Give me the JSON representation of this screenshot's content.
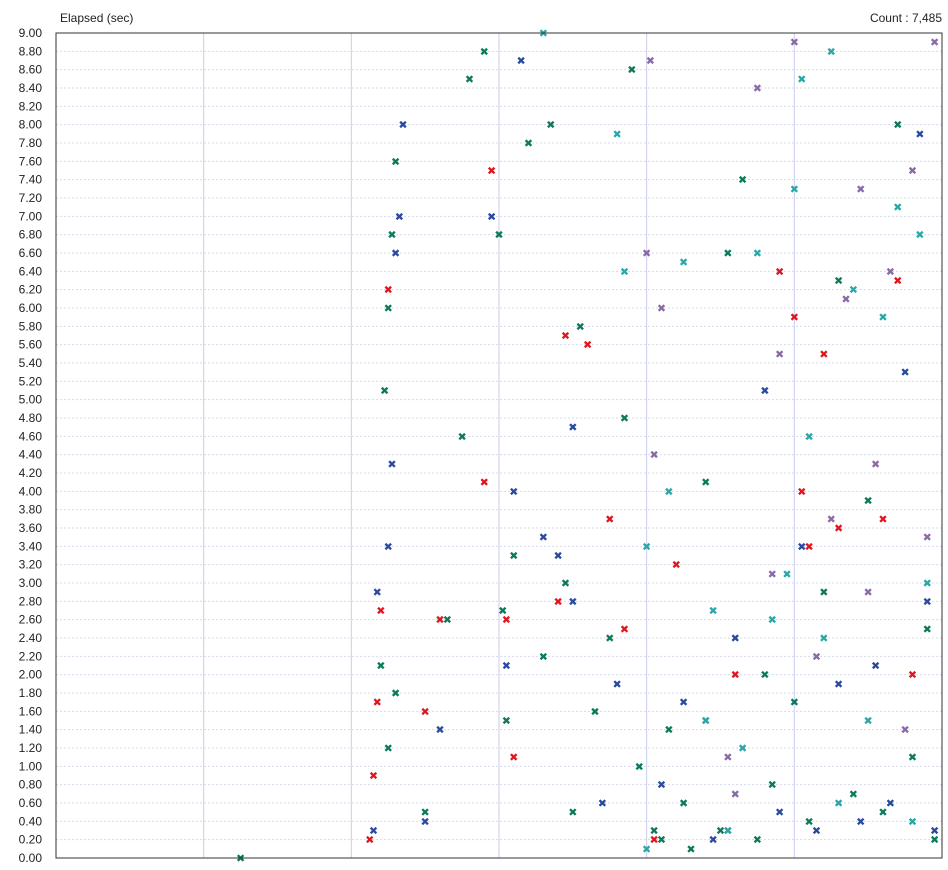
{
  "chart_data": {
    "type": "scatter",
    "title": "",
    "ylabel": "Elapsed (sec)",
    "xlabel": "",
    "count_label": "Count : 7,485",
    "ylim": [
      0,
      9.0
    ],
    "yticks": [
      "0.00",
      "0.20",
      "0.40",
      "0.60",
      "0.80",
      "1.00",
      "1.20",
      "1.40",
      "1.60",
      "1.80",
      "2.00",
      "2.20",
      "2.40",
      "2.60",
      "2.80",
      "3.00",
      "3.20",
      "3.40",
      "3.60",
      "3.80",
      "4.00",
      "4.20",
      "4.40",
      "4.60",
      "4.80",
      "5.00",
      "5.20",
      "5.40",
      "5.60",
      "5.80",
      "6.00",
      "6.20",
      "6.40",
      "6.60",
      "6.80",
      "7.00",
      "7.20",
      "7.40",
      "7.60",
      "7.80",
      "8.00",
      "8.20",
      "8.40",
      "8.60",
      "8.80",
      "9.00"
    ],
    "xlim_minutes": [
      0,
      12
    ],
    "xticks_minutes": [
      2,
      4,
      6,
      8,
      10,
      12
    ],
    "grid": true,
    "series": [
      {
        "color": "#0b7a5a",
        "points": [
          [
            2.5,
            0.0
          ],
          [
            4.4,
            2.1
          ],
          [
            4.5,
            1.2
          ],
          [
            4.6,
            1.8
          ],
          [
            4.45,
            5.1
          ],
          [
            4.5,
            6.0
          ],
          [
            4.55,
            6.8
          ],
          [
            4.6,
            7.6
          ],
          [
            5.0,
            0.5
          ],
          [
            5.3,
            2.6
          ],
          [
            5.5,
            4.6
          ],
          [
            5.6,
            8.5
          ],
          [
            5.8,
            8.8
          ],
          [
            6.0,
            6.8
          ],
          [
            6.05,
            2.7
          ],
          [
            6.1,
            1.5
          ],
          [
            6.2,
            3.3
          ],
          [
            6.4,
            7.8
          ],
          [
            6.6,
            2.2
          ],
          [
            6.7,
            8.0
          ],
          [
            6.9,
            3.0
          ],
          [
            7.0,
            0.5
          ],
          [
            7.1,
            5.8
          ],
          [
            7.3,
            1.6
          ],
          [
            7.5,
            2.4
          ],
          [
            7.7,
            4.8
          ],
          [
            7.8,
            8.6
          ],
          [
            7.9,
            1.0
          ],
          [
            8.1,
            0.3
          ],
          [
            8.2,
            0.2
          ],
          [
            8.3,
            1.4
          ],
          [
            8.5,
            0.6
          ],
          [
            8.6,
            0.1
          ],
          [
            8.8,
            4.1
          ],
          [
            9.0,
            0.3
          ],
          [
            9.1,
            6.6
          ],
          [
            9.3,
            7.4
          ],
          [
            9.5,
            0.2
          ],
          [
            9.6,
            2.0
          ],
          [
            9.7,
            0.8
          ],
          [
            10.0,
            1.7
          ],
          [
            10.2,
            0.4
          ],
          [
            10.4,
            2.9
          ],
          [
            10.6,
            6.3
          ],
          [
            10.8,
            0.7
          ],
          [
            11.0,
            3.9
          ],
          [
            11.2,
            0.5
          ],
          [
            11.4,
            8.0
          ],
          [
            11.6,
            1.1
          ],
          [
            11.8,
            2.5
          ],
          [
            11.9,
            0.2
          ]
        ]
      },
      {
        "color": "#2a4aa0",
        "points": [
          [
            4.3,
            0.3
          ],
          [
            4.35,
            2.9
          ],
          [
            4.5,
            3.4
          ],
          [
            4.55,
            4.3
          ],
          [
            4.6,
            6.6
          ],
          [
            4.65,
            7.0
          ],
          [
            4.7,
            8.0
          ],
          [
            5.0,
            0.4
          ],
          [
            5.2,
            1.4
          ],
          [
            5.9,
            7.0
          ],
          [
            6.1,
            2.1
          ],
          [
            6.2,
            4.0
          ],
          [
            6.3,
            8.7
          ],
          [
            6.6,
            3.5
          ],
          [
            6.8,
            3.3
          ],
          [
            7.0,
            2.8
          ],
          [
            7.0,
            4.7
          ],
          [
            7.4,
            0.6
          ],
          [
            7.6,
            1.9
          ],
          [
            8.2,
            0.8
          ],
          [
            8.5,
            1.7
          ],
          [
            8.9,
            0.2
          ],
          [
            9.2,
            2.4
          ],
          [
            9.6,
            5.1
          ],
          [
            9.8,
            0.5
          ],
          [
            10.1,
            3.4
          ],
          [
            10.3,
            0.3
          ],
          [
            10.6,
            1.9
          ],
          [
            10.9,
            0.4
          ],
          [
            11.1,
            2.1
          ],
          [
            11.3,
            0.6
          ],
          [
            11.5,
            5.3
          ],
          [
            11.7,
            7.9
          ],
          [
            11.8,
            2.8
          ],
          [
            11.9,
            0.3
          ]
        ]
      },
      {
        "color": "#e0161f",
        "points": [
          [
            4.25,
            0.2
          ],
          [
            4.3,
            0.9
          ],
          [
            4.35,
            1.7
          ],
          [
            4.4,
            2.7
          ],
          [
            4.5,
            6.2
          ],
          [
            5.0,
            1.6
          ],
          [
            5.2,
            2.6
          ],
          [
            5.8,
            4.1
          ],
          [
            5.9,
            7.5
          ],
          [
            6.1,
            2.6
          ],
          [
            6.2,
            1.1
          ],
          [
            6.8,
            2.8
          ],
          [
            6.9,
            5.7
          ],
          [
            7.2,
            5.6
          ],
          [
            7.5,
            3.7
          ],
          [
            7.7,
            2.5
          ],
          [
            8.1,
            0.2
          ],
          [
            8.4,
            3.2
          ],
          [
            8.8,
            1.5
          ],
          [
            9.1,
            0.3
          ],
          [
            9.2,
            2.0
          ],
          [
            9.8,
            6.4
          ],
          [
            10.0,
            5.9
          ],
          [
            10.1,
            4.0
          ],
          [
            10.2,
            3.4
          ],
          [
            10.4,
            5.5
          ],
          [
            10.6,
            3.6
          ],
          [
            11.2,
            3.7
          ],
          [
            11.4,
            6.3
          ],
          [
            11.6,
            2.0
          ]
        ]
      },
      {
        "color": "#2aa7a7",
        "points": [
          [
            6.6,
            9.0
          ],
          [
            7.6,
            7.9
          ],
          [
            7.7,
            6.4
          ],
          [
            8.0,
            0.1
          ],
          [
            8.0,
            3.4
          ],
          [
            8.3,
            4.0
          ],
          [
            8.5,
            6.5
          ],
          [
            8.8,
            1.5
          ],
          [
            8.9,
            2.7
          ],
          [
            9.1,
            0.3
          ],
          [
            9.3,
            1.2
          ],
          [
            9.5,
            6.6
          ],
          [
            9.7,
            2.6
          ],
          [
            9.9,
            3.1
          ],
          [
            10.0,
            7.3
          ],
          [
            10.1,
            8.5
          ],
          [
            10.2,
            4.6
          ],
          [
            10.4,
            2.4
          ],
          [
            10.5,
            8.8
          ],
          [
            10.6,
            0.6
          ],
          [
            10.8,
            6.2
          ],
          [
            11.0,
            1.5
          ],
          [
            11.2,
            5.9
          ],
          [
            11.4,
            7.1
          ],
          [
            11.6,
            0.4
          ],
          [
            11.7,
            6.8
          ],
          [
            11.8,
            3.0
          ]
        ]
      },
      {
        "color": "#8a6aa6",
        "points": [
          [
            8.0,
            6.6
          ],
          [
            8.05,
            8.7
          ],
          [
            8.1,
            4.4
          ],
          [
            8.2,
            6.0
          ],
          [
            9.1,
            1.1
          ],
          [
            9.2,
            0.7
          ],
          [
            9.5,
            8.4
          ],
          [
            9.7,
            3.1
          ],
          [
            9.8,
            5.5
          ],
          [
            10.0,
            8.9
          ],
          [
            10.3,
            2.2
          ],
          [
            10.5,
            3.7
          ],
          [
            10.7,
            6.1
          ],
          [
            10.9,
            7.3
          ],
          [
            11.0,
            2.9
          ],
          [
            11.1,
            4.3
          ],
          [
            11.3,
            6.4
          ],
          [
            11.5,
            1.4
          ],
          [
            11.6,
            7.5
          ],
          [
            11.8,
            3.5
          ],
          [
            11.9,
            8.9
          ]
        ]
      }
    ]
  }
}
